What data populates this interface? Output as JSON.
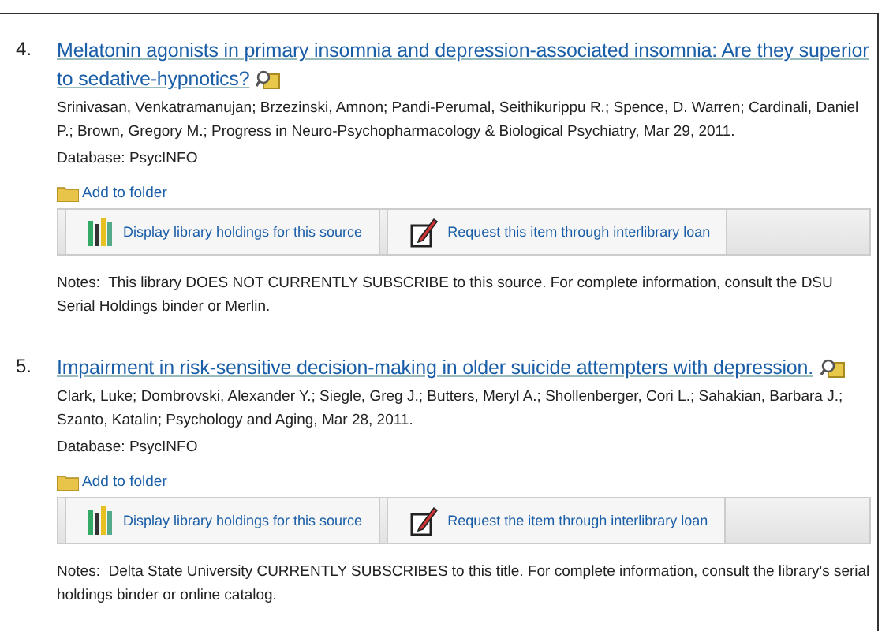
{
  "results": [
    {
      "number": "4.",
      "title": "Melatonin agonists in primary insomnia and depression-associated insomnia: Are they superior to sedative-hypnotics?",
      "authors": "Srinivasan, Venkatramanujan; Brzezinski, Amnon; Pandi-Perumal, Seithikurippu R.; Spence, D. Warren; Cardinali, Daniel P.; Brown, Gregory M.; Progress in Neuro-Psychopharmacology & Biological Psychiatry, Mar 29, 2011.",
      "database": "Database: PsycINFO",
      "add_to_folder": "Add to folder",
      "actions": [
        "Display library holdings for this source",
        "Request this item through interlibrary loan"
      ],
      "notes": "Notes:  This library DOES NOT CURRENTLY SUBSCRIBE to this source. For complete information, consult the DSU Serial Holdings binder or Merlin."
    },
    {
      "number": "5.",
      "title": "Impairment in risk-sensitive decision-making in older suicide attempters with depression.",
      "authors": "Clark, Luke; Dombrovski, Alexander Y.; Siegle, Greg J.; Butters, Meryl A.; Shollenberger, Cori L.; Sahakian, Barbara J.; Szanto, Katalin; Psychology and Aging, Mar 28, 2011.",
      "database": "Database: PsycINFO",
      "add_to_folder": "Add to folder",
      "actions": [
        "Display library holdings for this source",
        "Request the item through interlibrary loan"
      ],
      "notes": "Notes:  Delta State University CURRENTLY SUBSCRIBES to this title. For complete information, consult the library's serial holdings binder or online catalog."
    }
  ]
}
